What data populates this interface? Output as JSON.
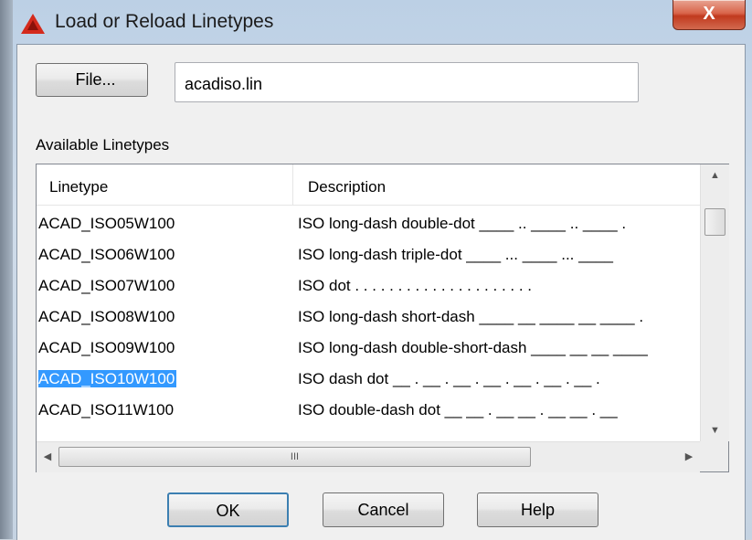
{
  "window": {
    "title": "Load or Reload Linetypes",
    "close_glyph": "X",
    "app_icon": "autocad-logo-icon"
  },
  "file": {
    "button_label": "File...",
    "filename": "acadiso.lin"
  },
  "list": {
    "label": "Available Linetypes",
    "columns": [
      "Linetype",
      "Description"
    ],
    "rows": [
      {
        "linetype": "ACAD_ISO05W100",
        "description": "ISO long-dash double-dot ____ .. ____ .. ____ ."
      },
      {
        "linetype": "ACAD_ISO06W100",
        "description": "ISO long-dash triple-dot ____ ... ____ ... ____"
      },
      {
        "linetype": "ACAD_ISO07W100",
        "description": "ISO dot . . . . . . . . . . . . . . . . . . . . ."
      },
      {
        "linetype": "ACAD_ISO08W100",
        "description": "ISO long-dash short-dash ____ __ ____ __ ____ ."
      },
      {
        "linetype": "ACAD_ISO09W100",
        "description": "ISO long-dash double-short-dash ____ __ __ ____"
      },
      {
        "linetype": "ACAD_ISO10W100",
        "description": "ISO dash dot __ . __ . __ . __ . __ . __ . __ ."
      },
      {
        "linetype": "ACAD_ISO11W100",
        "description": "ISO double-dash dot __ __ . __ __ . __ __ . __"
      }
    ],
    "selected_index": 5,
    "hscroll_grip": "III"
  },
  "buttons": {
    "ok": "OK",
    "cancel": "Cancel",
    "help": "Help"
  },
  "colors": {
    "selection": "#3399ff",
    "close_button": "#c13a1e"
  }
}
